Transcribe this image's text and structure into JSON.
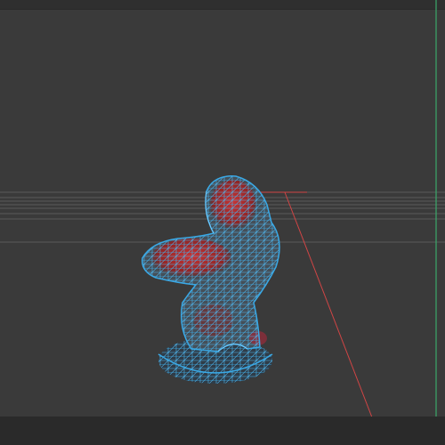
{
  "viewport": {
    "background_color": "#3a3a3a",
    "grid_color": "#5a5a5a",
    "axis_red_color": "#d04545",
    "axis_green_color": "#3aa86a",
    "wireframe_color": "#3aa9e6",
    "shading_red_color": "#b92a2a",
    "panel_color": "#2a2a2a"
  },
  "object": {
    "name": "sculpture-mesh",
    "display_mode": "wireframe-over-shaded"
  }
}
